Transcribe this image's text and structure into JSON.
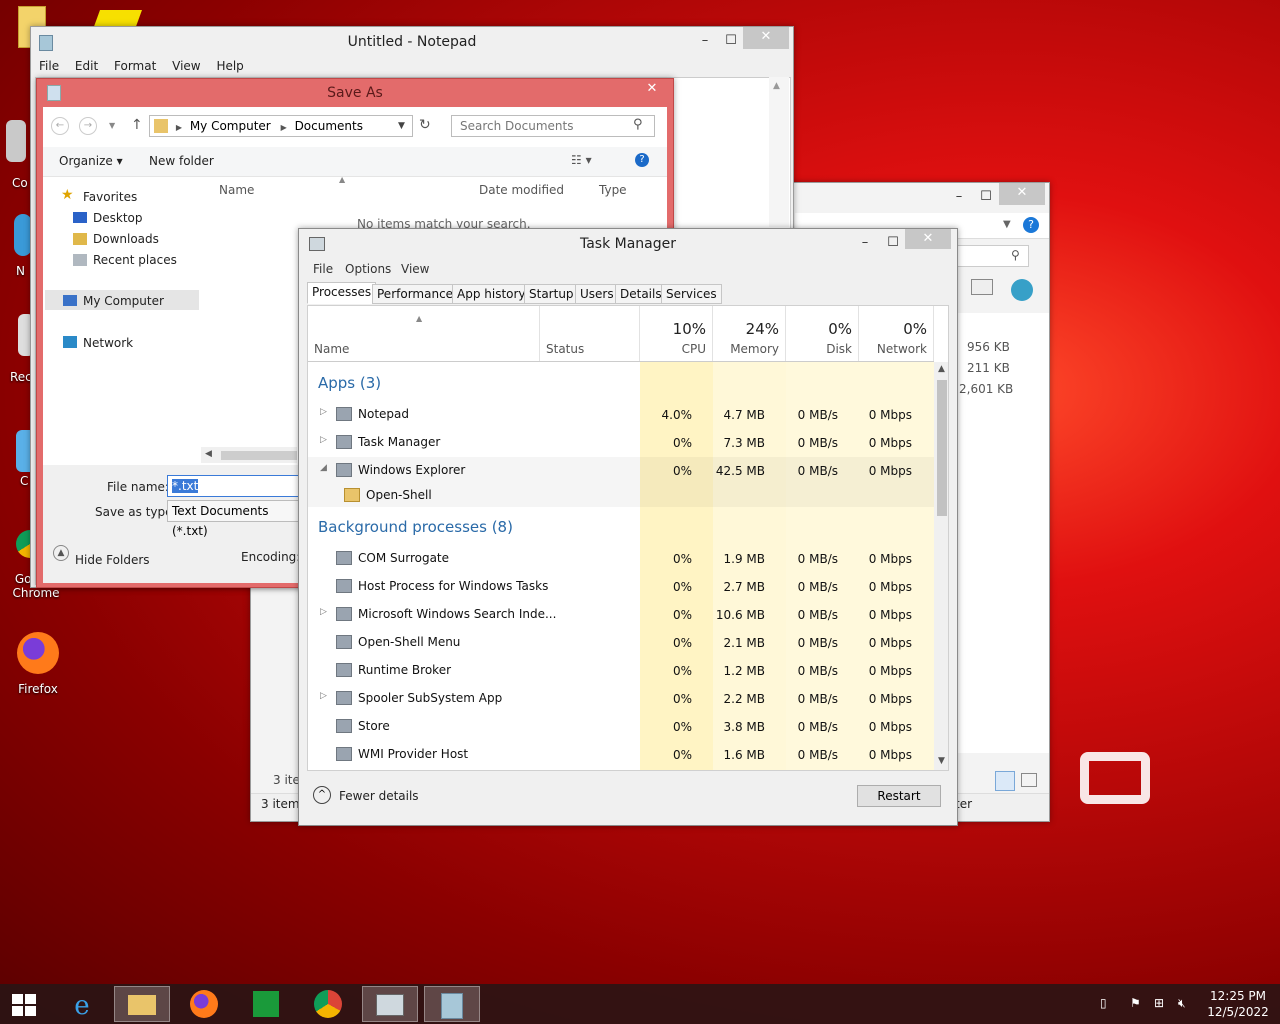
{
  "desktop": {
    "icons": [
      {
        "label": "Co",
        "top": 0
      },
      {
        "label": "N",
        "top": 0
      },
      {
        "label": "Rec",
        "top": 0
      },
      {
        "label": "C",
        "top": 0
      },
      {
        "label": "Google Chrome",
        "top": 0
      },
      {
        "label": "Firefox",
        "top": 0
      }
    ]
  },
  "notepad": {
    "title": "Untitled - Notepad",
    "menu": [
      "File",
      "Edit",
      "Format",
      "View",
      "Help"
    ]
  },
  "saveas": {
    "title": "Save As",
    "breadcrumb": [
      "My Computer",
      "Documents"
    ],
    "search_placeholder": "Search Documents",
    "organize": "Organize",
    "new_folder": "New folder",
    "columns": [
      "Name",
      "Date modified",
      "Type"
    ],
    "empty_msg": "No items match your search.",
    "nav": [
      "Favorites",
      "Desktop",
      "Downloads",
      "Recent places",
      "My Computer",
      "Network"
    ],
    "file_name_label": "File name:",
    "file_name_value": "*.txt",
    "save_type_label": "Save as type:",
    "save_type_value": "Text Documents (*.txt)",
    "hide_folders": "Hide Folders",
    "encoding_label": "Encoding:"
  },
  "explorer": {
    "sizes": [
      "956 KB",
      "211 KB",
      "2,601 KB"
    ],
    "items_count": "3 items",
    "status_items": "3 iter",
    "status_right": "ter"
  },
  "taskmanager": {
    "title": "Task Manager",
    "menu": [
      "File",
      "Options",
      "View"
    ],
    "tabs": [
      "Processes",
      "Performance",
      "App history",
      "Startup",
      "Users",
      "Details",
      "Services"
    ],
    "headers": {
      "name": "Name",
      "status": "Status",
      "cpu_pct": "10%",
      "cpu": "CPU",
      "mem_pct": "24%",
      "mem": "Memory",
      "disk_pct": "0%",
      "disk": "Disk",
      "net_pct": "0%",
      "net": "Network"
    },
    "apps_group": "Apps (3)",
    "apps": [
      {
        "name": "Notepad",
        "cpu": "4.0%",
        "mem": "4.7 MB",
        "disk": "0 MB/s",
        "net": "0 Mbps"
      },
      {
        "name": "Task Manager",
        "cpu": "0%",
        "mem": "7.3 MB",
        "disk": "0 MB/s",
        "net": "0 Mbps"
      },
      {
        "name": "Windows Explorer",
        "cpu": "0%",
        "mem": "42.5 MB",
        "disk": "0 MB/s",
        "net": "0 Mbps"
      }
    ],
    "child": "Open-Shell",
    "bg_group": "Background processes (8)",
    "bg": [
      {
        "name": "COM Surrogate",
        "cpu": "0%",
        "mem": "1.9 MB",
        "disk": "0 MB/s",
        "net": "0 Mbps"
      },
      {
        "name": "Host Process for Windows Tasks",
        "cpu": "0%",
        "mem": "2.7 MB",
        "disk": "0 MB/s",
        "net": "0 Mbps"
      },
      {
        "name": "Microsoft Windows Search Inde...",
        "cpu": "0%",
        "mem": "10.6 MB",
        "disk": "0 MB/s",
        "net": "0 Mbps"
      },
      {
        "name": "Open-Shell Menu",
        "cpu": "0%",
        "mem": "2.1 MB",
        "disk": "0 MB/s",
        "net": "0 Mbps"
      },
      {
        "name": "Runtime Broker",
        "cpu": "0%",
        "mem": "1.2 MB",
        "disk": "0 MB/s",
        "net": "0 Mbps"
      },
      {
        "name": "Spooler SubSystem App",
        "cpu": "0%",
        "mem": "2.2 MB",
        "disk": "0 MB/s",
        "net": "0 Mbps"
      },
      {
        "name": "Store",
        "cpu": "0%",
        "mem": "3.8 MB",
        "disk": "0 MB/s",
        "net": "0 Mbps"
      },
      {
        "name": "WMI Provider Host",
        "cpu": "0%",
        "mem": "1.6 MB",
        "disk": "0 MB/s",
        "net": "0 Mbps"
      }
    ],
    "fewer_details": "Fewer details",
    "restart": "Restart"
  },
  "taskbar": {
    "time": "12:25 PM",
    "date": "12/5/2022"
  }
}
